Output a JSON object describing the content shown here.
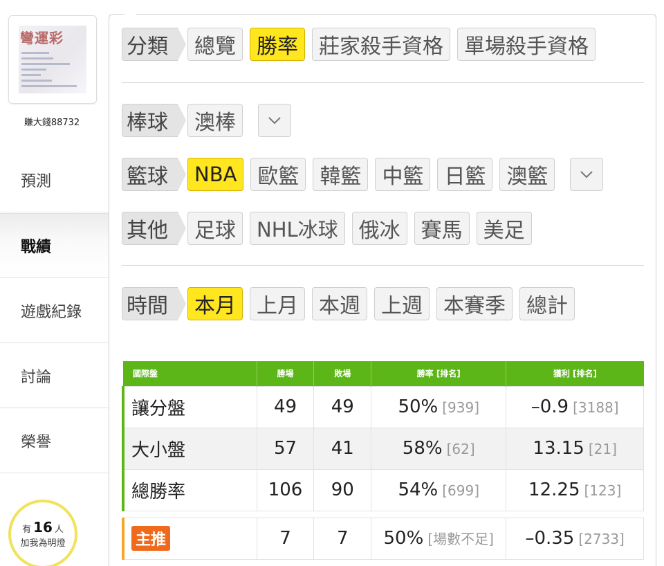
{
  "user": {
    "name": "賺大錢88732",
    "avatar_logo_text": "彎運彩"
  },
  "nav": {
    "items": [
      {
        "label": "預測"
      },
      {
        "label": "戰績"
      },
      {
        "label": "遊戲紀錄"
      },
      {
        "label": "討論"
      },
      {
        "label": "榮譽"
      }
    ],
    "active": "戰績"
  },
  "fans": {
    "prefix": "有",
    "count": "16",
    "unit": "人",
    "caption": "加我為明燈"
  },
  "filters": {
    "category": {
      "label": "分類",
      "options": [
        "總覽",
        "勝率",
        "莊家殺手資格",
        "單場殺手資格"
      ],
      "active": "勝率"
    },
    "baseball": {
      "label": "棒球",
      "options": [
        "澳棒"
      ]
    },
    "basketball": {
      "label": "籃球",
      "options": [
        "NBA",
        "歐籃",
        "韓籃",
        "中籃",
        "日籃",
        "澳籃"
      ],
      "active": "NBA"
    },
    "other": {
      "label": "其他",
      "options": [
        "足球",
        "NHL冰球",
        "俄冰",
        "賽馬",
        "美足"
      ]
    },
    "time": {
      "label": "時間",
      "options": [
        "本月",
        "上月",
        "本週",
        "上週",
        "本賽季",
        "總計"
      ],
      "active": "本月"
    }
  },
  "table": {
    "headers": [
      "國際盤",
      "勝場",
      "敗場",
      "勝率 [排名]",
      "獲利 [排名]"
    ],
    "rows": [
      {
        "name": "讓分盤",
        "wins": "49",
        "losses": "49",
        "rate": "50%",
        "rate_rank": "[939]",
        "profit": "–0.9",
        "profit_rank": "[3188]"
      },
      {
        "name": "大小盤",
        "wins": "57",
        "losses": "41",
        "rate": "58%",
        "rate_rank": "[62]",
        "profit": "13.15",
        "profit_rank": "[21]"
      },
      {
        "name": "總勝率",
        "wins": "106",
        "losses": "90",
        "rate": "54%",
        "rate_rank": "[699]",
        "profit": "12.25",
        "profit_rank": "[123]"
      }
    ],
    "pick_row": {
      "badge": "主推",
      "wins": "7",
      "losses": "7",
      "rate": "50%",
      "rate_rank": "[場數不足]",
      "profit": "–0.35",
      "profit_rank": "[2733]"
    }
  },
  "colors": {
    "accent_yellow": "#ffe61e",
    "header_green": "#5cb617",
    "pick_orange": "#f06a1e"
  }
}
